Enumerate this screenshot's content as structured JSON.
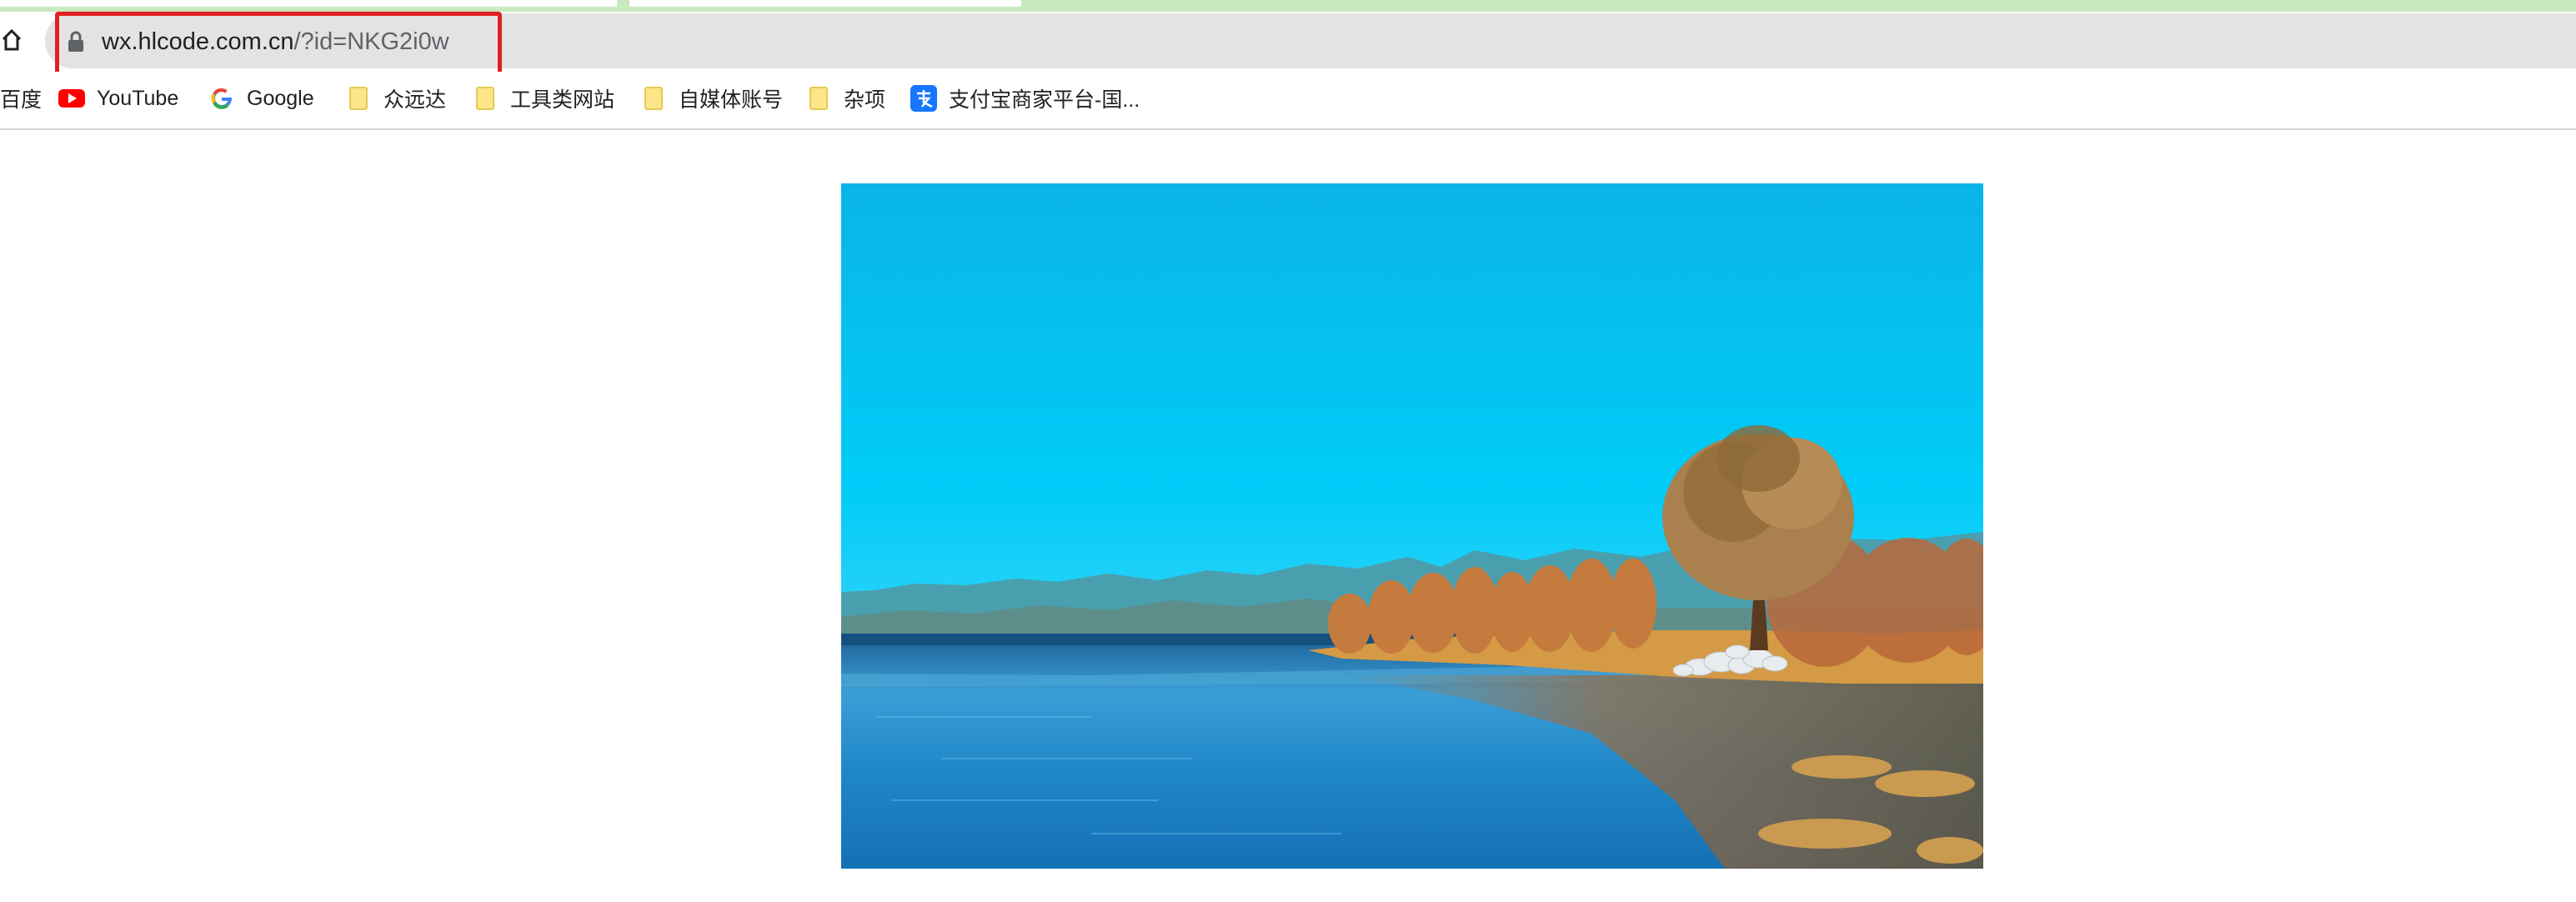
{
  "browser": {
    "url_host": "wx.hlcode.com.cn",
    "url_rest": "/?id=NKG2i0w"
  },
  "bookmarks": [
    {
      "label": "百度",
      "icon": "baidu-icon"
    },
    {
      "label": "YouTube",
      "icon": "youtube-icon"
    },
    {
      "label": "Google",
      "icon": "google-icon"
    },
    {
      "label": "众远达",
      "icon": "folder-icon"
    },
    {
      "label": "工具类网站",
      "icon": "folder-icon"
    },
    {
      "label": "自媒体账号",
      "icon": "folder-icon"
    },
    {
      "label": "杂项",
      "icon": "folder-icon"
    },
    {
      "label": "支付宝商家平台-国...",
      "icon": "alipay-icon"
    }
  ],
  "colors": {
    "highlight": "#e02020",
    "sky": "#00c4f2",
    "water": "#1a7fc0"
  }
}
